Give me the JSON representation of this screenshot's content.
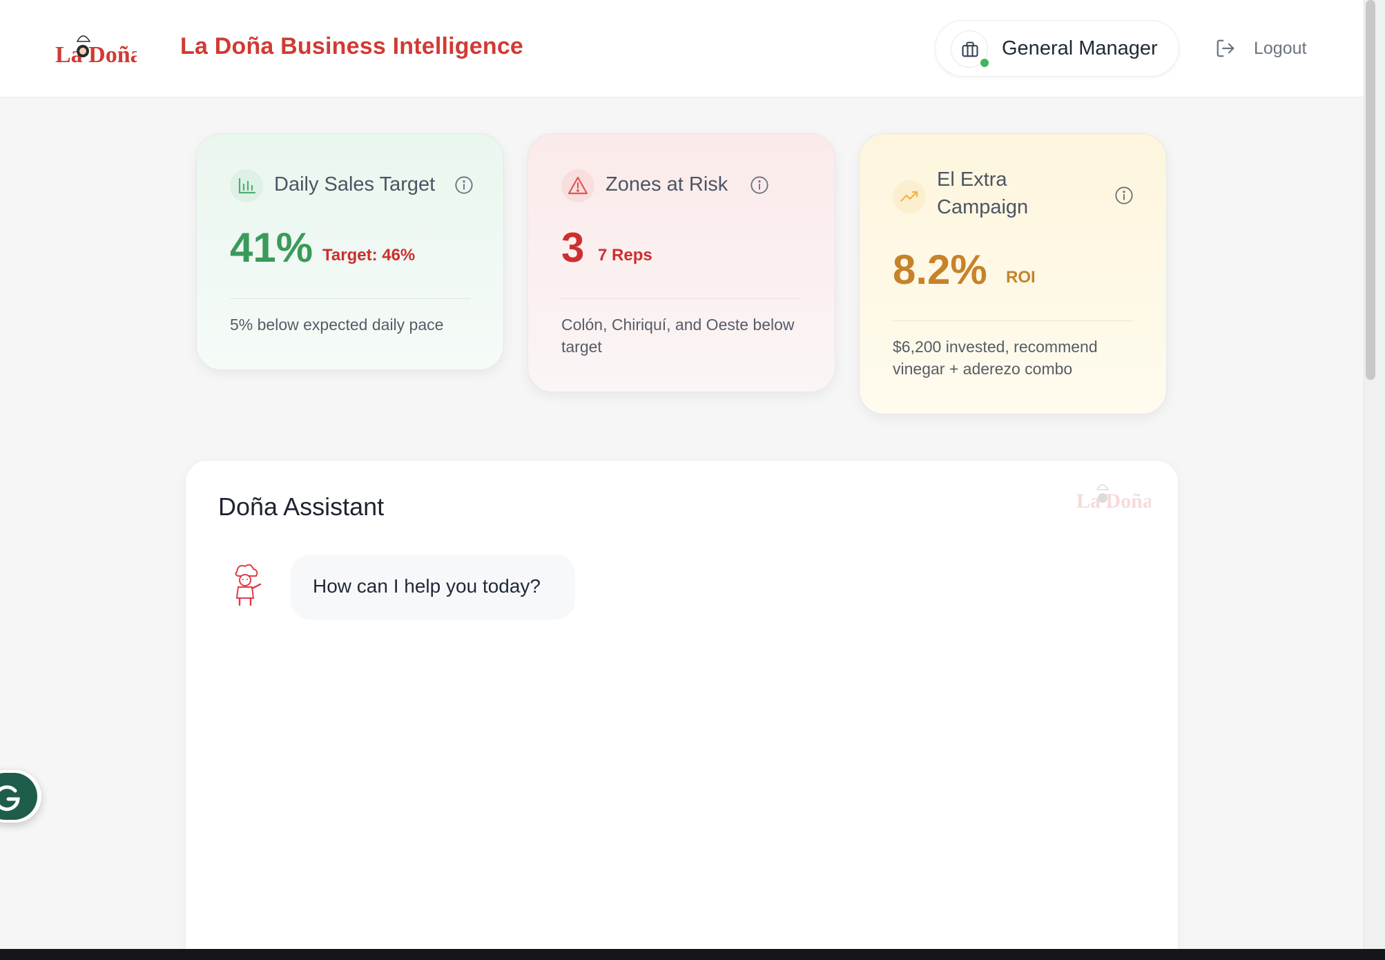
{
  "header": {
    "logo_text": "La Doña",
    "app_title": "La Doña Business Intelligence",
    "role_label": "General Manager",
    "logout_label": "Logout"
  },
  "kpi_cards": [
    {
      "title": "Daily Sales Target",
      "value": "41%",
      "sub_value": "Target: 46%",
      "description": "5% below expected daily pace",
      "icon": "bar-chart-icon",
      "accent": "#3a9a5a"
    },
    {
      "title": "Zones at Risk",
      "value": "3",
      "sub_value": "7 Reps",
      "description": "Colón, Chiriquí, and Oeste below target",
      "icon": "warning-triangle-icon",
      "accent": "#cc2f2f"
    },
    {
      "title": "El Extra Campaign",
      "value": "8.2%",
      "sub_value": "ROI",
      "description": "$6,200 invested, recommend vinegar + aderezo combo",
      "icon": "trending-up-icon",
      "accent": "#c7822a"
    }
  ],
  "assistant": {
    "title": "Doña Assistant",
    "watermark_text": "La Doña",
    "messages": [
      {
        "sender": "bot",
        "text": "How can I help you today?"
      }
    ]
  },
  "floating_button": {
    "icon": "grammarly-g-icon",
    "color": "#1e5c4b"
  },
  "colors": {
    "brand_red": "#d13a34",
    "online_green": "#3fb65b",
    "green_value": "#3a9a5a",
    "red_value": "#cc2f2f",
    "amber_value": "#c7822a"
  }
}
